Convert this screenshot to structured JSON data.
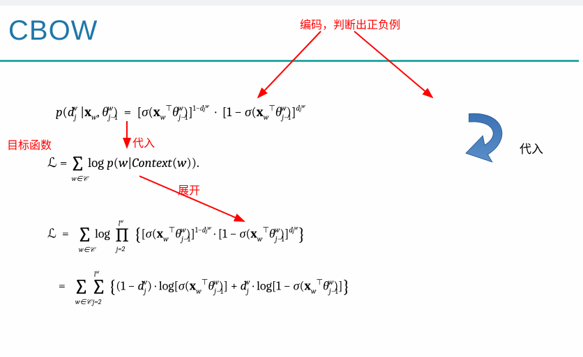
{
  "title": "CBOW",
  "annotations": {
    "encode_posneg": "编码，判断出正负例",
    "objective": "目标函数",
    "substitute": "代入",
    "expand": "展开",
    "substitute_right": "代入"
  },
  "equations": {
    "eq1": "p(d_j^w | x_w, θ_{j-1}^w) = [σ(x_w^⊤ θ_{j-1}^w)]^{1−d_j^w} · [1 − σ(x_w^⊤ θ_{j-1}^w)]^{d_j^w}",
    "eq2": "ℒ = Σ_{w∈𝒞} log p(w | Context(w)).",
    "eq3": "ℒ = Σ_{w∈𝒞} log ∏_{j=2}^{l^w} { [σ(x_w^⊤ θ_{j-1}^w)]^{1−d_j^w} · [1 − σ(x_w^⊤ θ_{j-1}^w)]^{d_j^w} }",
    "eq4": "= Σ_{w∈𝒞} Σ_{j=2}^{l^w} { (1 − d_j^w) · log[σ(x_w^⊤ θ_{j-1}^w)] + d_j^w · log[1 − σ(x_w^⊤ θ_{j-1}^w)] }"
  }
}
